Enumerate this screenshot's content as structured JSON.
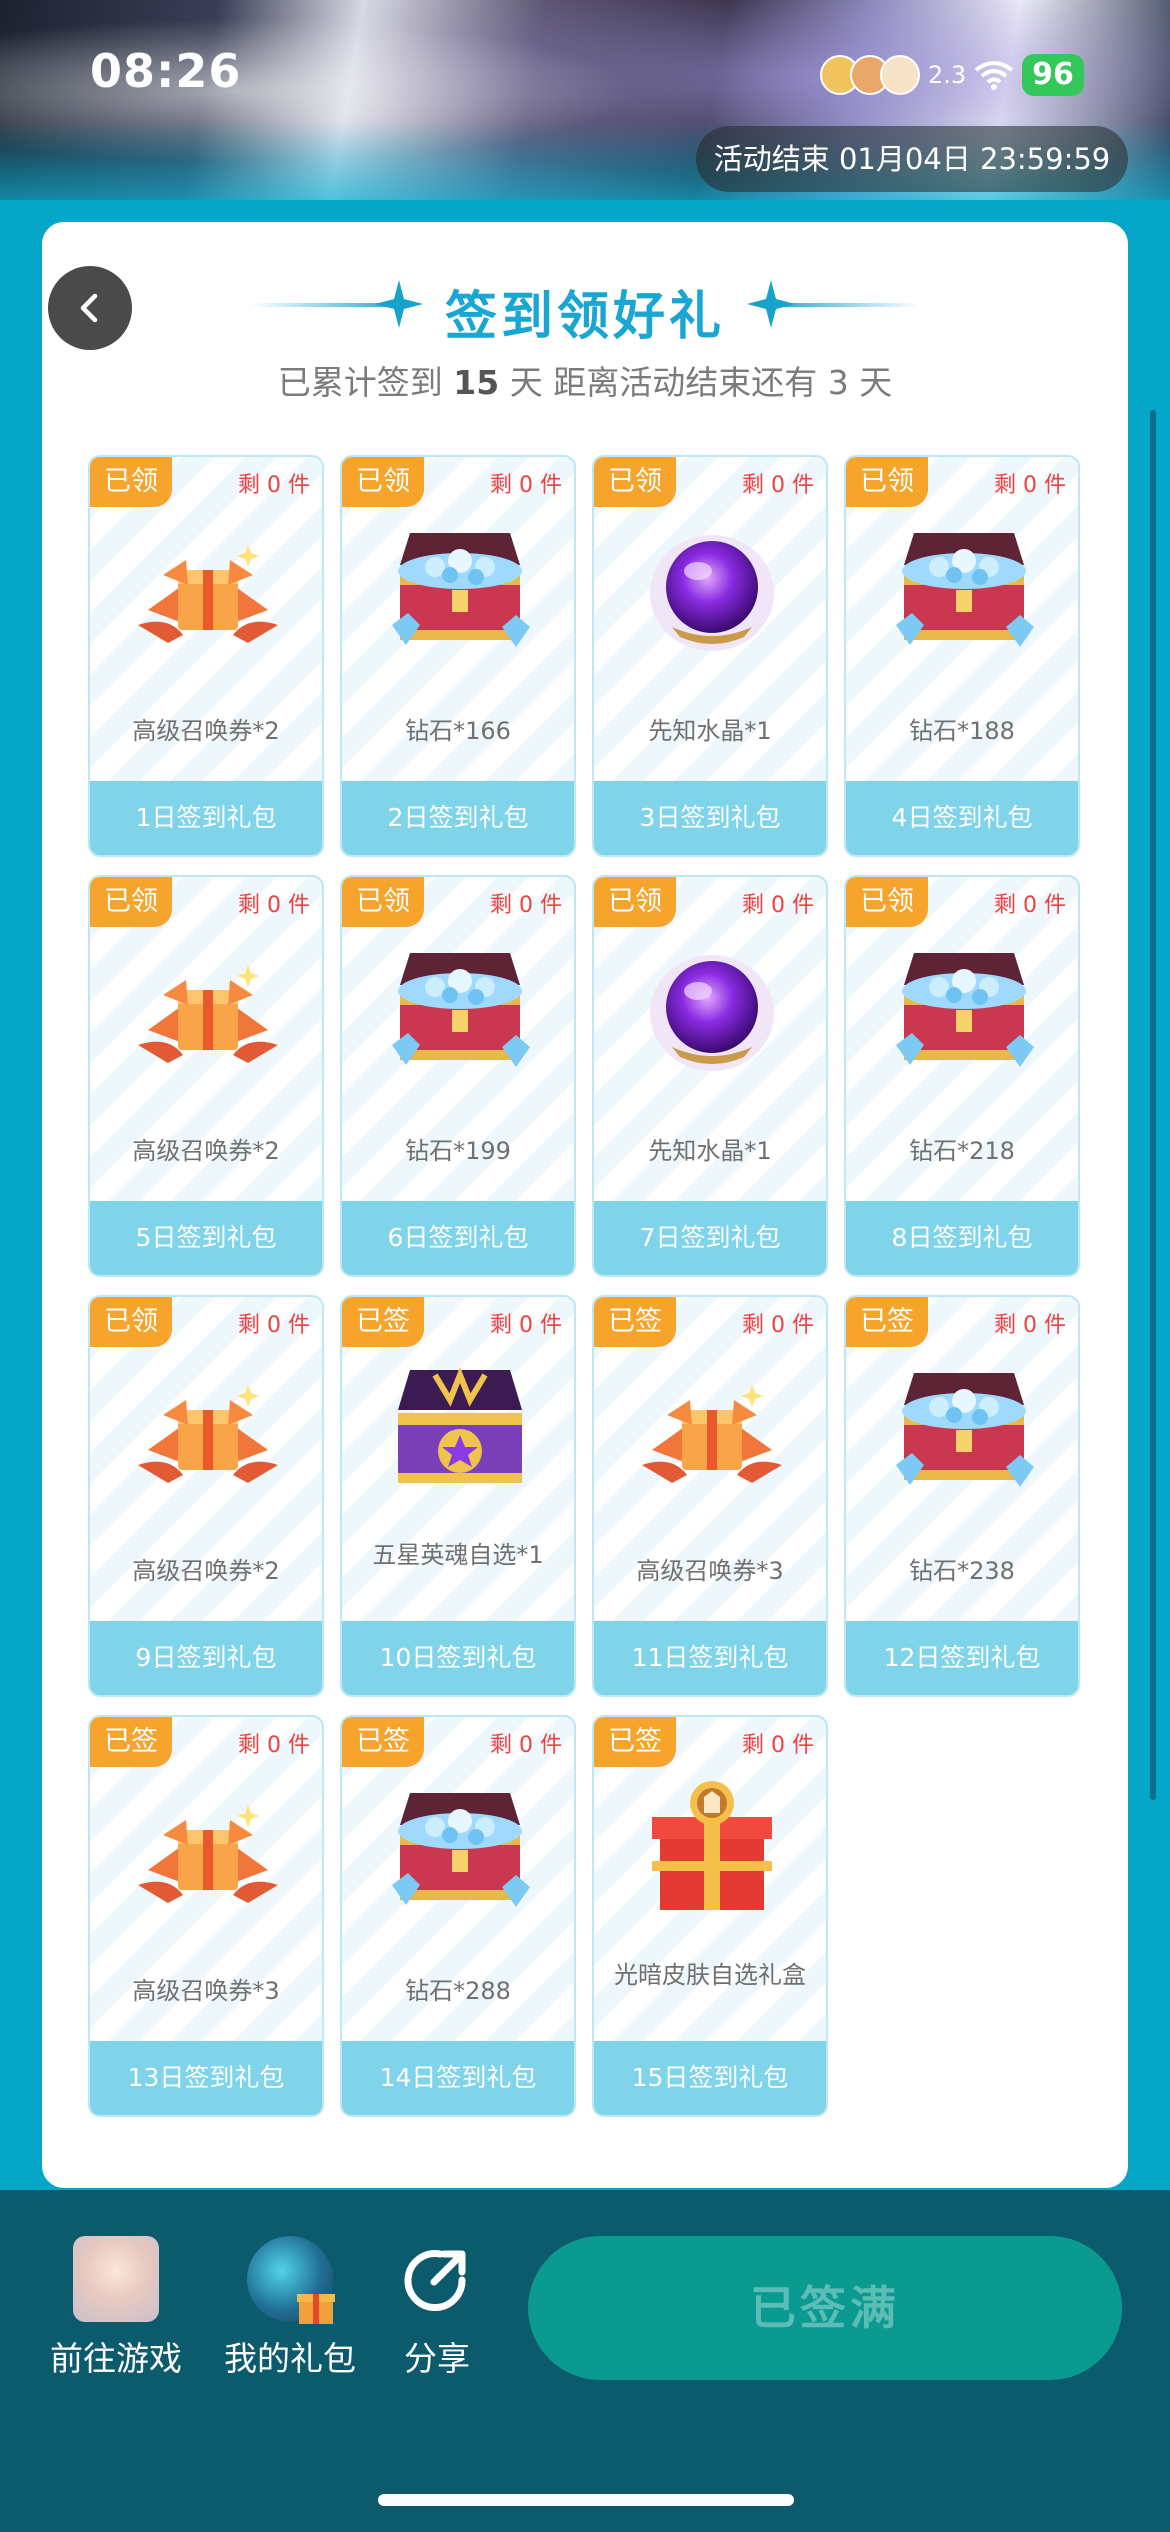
{
  "status_bar": {
    "time": "08:26",
    "speed": "2.3",
    "battery": "96"
  },
  "activity": {
    "end_label": "活动结束 01月04日 23:59:59"
  },
  "header": {
    "title": "签到领好礼",
    "sub_prefix": "已累计签到",
    "sub_days": "15",
    "sub_middle": "天  距离活动结束还有 3 天"
  },
  "tiles": [
    {
      "badge": "已领",
      "remain": "剩 0 件",
      "reward": "高级召唤券*2",
      "label": "1日签到礼包",
      "icon": "ticket-bundle-icon"
    },
    {
      "badge": "已领",
      "remain": "剩 0 件",
      "reward": "钻石*166",
      "label": "2日签到礼包",
      "icon": "diamond-chest-icon"
    },
    {
      "badge": "已领",
      "remain": "剩 0 件",
      "reward": "先知水晶*1",
      "label": "3日签到礼包",
      "icon": "crystal-orb-icon"
    },
    {
      "badge": "已领",
      "remain": "剩 0 件",
      "reward": "钻石*188",
      "label": "4日签到礼包",
      "icon": "diamond-chest-icon"
    },
    {
      "badge": "已领",
      "remain": "剩 0 件",
      "reward": "高级召唤券*2",
      "label": "5日签到礼包",
      "icon": "ticket-bundle-icon"
    },
    {
      "badge": "已领",
      "remain": "剩 0 件",
      "reward": "钻石*199",
      "label": "6日签到礼包",
      "icon": "diamond-chest-icon"
    },
    {
      "badge": "已领",
      "remain": "剩 0 件",
      "reward": "先知水晶*1",
      "label": "7日签到礼包",
      "icon": "crystal-orb-icon"
    },
    {
      "badge": "已领",
      "remain": "剩 0 件",
      "reward": "钻石*218",
      "label": "8日签到礼包",
      "icon": "diamond-chest-icon"
    },
    {
      "badge": "已领",
      "remain": "剩 0 件",
      "reward": "高级召唤券*2",
      "label": "9日签到礼包",
      "icon": "ticket-bundle-icon"
    },
    {
      "badge": "已签",
      "remain": "剩 0 件",
      "reward": "五星英魂自选*1",
      "label": "10日签到礼包",
      "icon": "hero-chest-icon"
    },
    {
      "badge": "已签",
      "remain": "剩 0 件",
      "reward": "高级召唤券*3",
      "label": "11日签到礼包",
      "icon": "ticket-bundle-icon"
    },
    {
      "badge": "已签",
      "remain": "剩 0 件",
      "reward": "钻石*238",
      "label": "12日签到礼包",
      "icon": "diamond-chest-icon"
    },
    {
      "badge": "已签",
      "remain": "剩 0 件",
      "reward": "高级召唤券*3",
      "label": "13日签到礼包",
      "icon": "ticket-bundle-icon"
    },
    {
      "badge": "已签",
      "remain": "剩 0 件",
      "reward": "钻石*288",
      "label": "14日签到礼包",
      "icon": "diamond-chest-icon"
    },
    {
      "badge": "已签",
      "remain": "剩 0 件",
      "reward": "光暗皮肤自选礼盒",
      "label": "15日签到礼包",
      "icon": "skin-gift-box-icon"
    }
  ],
  "bottom_bar": {
    "go_game": "前往游戏",
    "my_gifts": "我的礼包",
    "share": "分享",
    "main_button": "已签满"
  },
  "colors": {
    "accent": "#1aa6d2",
    "badge": "#f6a42b",
    "remain": "#f04040",
    "tile_footer": "#7fd4ea",
    "main_button": "#0b9a90"
  }
}
